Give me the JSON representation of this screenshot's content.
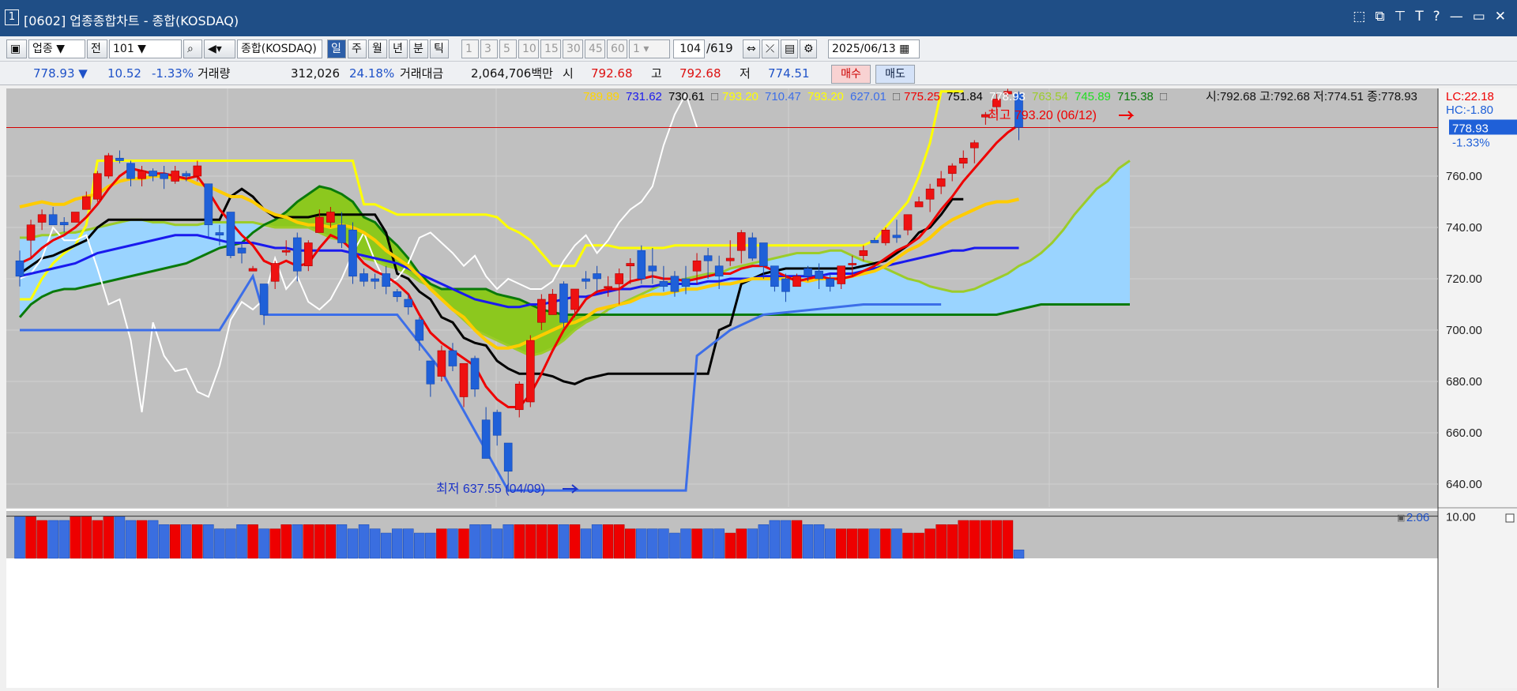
{
  "window": {
    "number": "1",
    "title": "[0602] 업종종합차트 - 종합(KOSDAQ)",
    "controls": [
      "⬚",
      "⧉",
      "⊤",
      "T",
      "?",
      "—",
      "▭",
      "✕"
    ]
  },
  "toolbar": {
    "type_select": "업종",
    "prev_btn": "전",
    "code": "101",
    "market_name": "종합(KOSDAQ)",
    "periods": [
      "일",
      "주",
      "월",
      "년",
      "분",
      "틱"
    ],
    "selected_period": "일",
    "intervals": [
      "1",
      "3",
      "5",
      "10",
      "15",
      "30",
      "45",
      "60"
    ],
    "interval_value": "1",
    "count_current": "104",
    "count_total": "/619",
    "date": "2025/06/13"
  },
  "quote": {
    "price": "778.93 ▼",
    "change": "10.52",
    "change_pct": "-1.33%",
    "volume_label": "거래량",
    "volume": "312,026",
    "volume_pct": "24.18%",
    "amount_label": "거래대금",
    "amount": "2,064,706백만",
    "open_label": "시",
    "open": "792.68",
    "high_label": "고",
    "high": "792.68",
    "low_label": "저",
    "low": "774.51",
    "buy_label": "매수",
    "sell_label": "매도"
  },
  "legend": {
    "items": [
      {
        "text": "789.89",
        "color": "#ffd400"
      },
      {
        "text": "731.62",
        "color": "#1a1aee"
      },
      {
        "text": "730.61",
        "color": "#000000"
      },
      {
        "text": "□",
        "color": "#555555"
      },
      {
        "text": "793.20",
        "color": "#ffff00"
      },
      {
        "text": "710.47",
        "color": "#3c6ee8"
      },
      {
        "text": "793.20",
        "color": "#ffff00"
      },
      {
        "text": "627.01",
        "color": "#3c6ee8"
      },
      {
        "text": "□",
        "color": "#555555"
      },
      {
        "text": "775.25",
        "color": "#ee0000"
      },
      {
        "text": "751.84",
        "color": "#000000"
      },
      {
        "text": "778.93",
        "color": "#ffffff"
      },
      {
        "text": "763.54",
        "color": "#9ccc2a"
      },
      {
        "text": "745.89",
        "color": "#22dd22"
      },
      {
        "text": "715.38",
        "color": "#0a7a0a"
      },
      {
        "text": "□",
        "color": "#555555"
      }
    ],
    "ohlc": "시:792.68 고:792.68 저:774.51 종:778.93",
    "lc": "LC:22.18",
    "hc": "HC:-1.80"
  },
  "annotations": {
    "high": "최고 793.20 (06/12)",
    "low": "최저 637.55 (04/09)"
  },
  "price_axis": {
    "ticks": [
      "760.00",
      "740.00",
      "720.00",
      "700.00",
      "680.00",
      "660.00",
      "640.00"
    ],
    "current": "778.93",
    "current_pct": "-1.33%"
  },
  "volume_axis": {
    "ticks": [
      "10.00"
    ],
    "badge": "2.06",
    "badge_icon": "▣"
  },
  "colors": {
    "up": "#ee1111",
    "down": "#1f60d8",
    "background": "#c0c0c0",
    "cloud_bull": "#9ad4ff",
    "cloud_bear": "#8cc81e"
  },
  "chart_data": {
    "type": "candlestick",
    "ohlc": [
      [
        727,
        731,
        717,
        721
      ],
      [
        735,
        743,
        728,
        741
      ],
      [
        742,
        747,
        739,
        745
      ],
      [
        745,
        748,
        741,
        741
      ],
      [
        742,
        744,
        738,
        741
      ],
      [
        742,
        746,
        742,
        746
      ],
      [
        747,
        754,
        747,
        752
      ],
      [
        751,
        762,
        750,
        761
      ],
      [
        760,
        769,
        759,
        768
      ],
      [
        767,
        770,
        765,
        766
      ],
      [
        765,
        766,
        756,
        759
      ],
      [
        759,
        764,
        756,
        762
      ],
      [
        762,
        763,
        758,
        760
      ],
      [
        761,
        764,
        755,
        759
      ],
      [
        758,
        764,
        757,
        762
      ],
      [
        761,
        762,
        758,
        760
      ],
      [
        760,
        766,
        758,
        764
      ],
      [
        757,
        756,
        736,
        741
      ],
      [
        738,
        741,
        733,
        737
      ],
      [
        746,
        746,
        728,
        729
      ],
      [
        732,
        734,
        726,
        730
      ],
      [
        723,
        725,
        723,
        724
      ],
      [
        718,
        718,
        702,
        706
      ],
      [
        719,
        727,
        716,
        726
      ],
      [
        731,
        735,
        729,
        731
      ],
      [
        736,
        738,
        719,
        723
      ],
      [
        725,
        735,
        723,
        734
      ],
      [
        738,
        747,
        738,
        744
      ],
      [
        742,
        748,
        740,
        746
      ],
      [
        741,
        746,
        732,
        734
      ],
      [
        739,
        742,
        718,
        721
      ],
      [
        722,
        724,
        717,
        719
      ],
      [
        720,
        722,
        716,
        719
      ],
      [
        722,
        725,
        714,
        717
      ],
      [
        715,
        716,
        711,
        713
      ],
      [
        712,
        714,
        706,
        709
      ],
      [
        704,
        705,
        692,
        696
      ],
      [
        688,
        688,
        674,
        679
      ],
      [
        682,
        694,
        680,
        692
      ],
      [
        692,
        695,
        684,
        686
      ],
      [
        674,
        683,
        670,
        687
      ],
      [
        689,
        690,
        674,
        677
      ],
      [
        665,
        670,
        650,
        650
      ],
      [
        668,
        669,
        655,
        659
      ],
      [
        656,
        656,
        637,
        645
      ],
      [
        669,
        680,
        666,
        679
      ],
      [
        672,
        698,
        670,
        696
      ],
      [
        703,
        714,
        700,
        712
      ],
      [
        706,
        716,
        706,
        714
      ],
      [
        718,
        719,
        701,
        703
      ],
      [
        708,
        716,
        705,
        716
      ],
      [
        720,
        723,
        716,
        719
      ],
      [
        722,
        725,
        715,
        720
      ],
      [
        717,
        721,
        713,
        717
      ],
      [
        718,
        724,
        710,
        722
      ],
      [
        725,
        728,
        718,
        726
      ],
      [
        731,
        733,
        718,
        720
      ],
      [
        725,
        732,
        718,
        723
      ],
      [
        719,
        725,
        715,
        717
      ],
      [
        721,
        723,
        713,
        715
      ],
      [
        720,
        725,
        714,
        717
      ],
      [
        723,
        730,
        718,
        727
      ],
      [
        729,
        732,
        720,
        727
      ],
      [
        725,
        729,
        716,
        721
      ],
      [
        727,
        735,
        725,
        728
      ],
      [
        731,
        739,
        726,
        738
      ],
      [
        736,
        738,
        727,
        728
      ],
      [
        734,
        734,
        720,
        725
      ],
      [
        725,
        725,
        715,
        717
      ],
      [
        720,
        722,
        711,
        715
      ],
      [
        717,
        722,
        717,
        721
      ],
      [
        724,
        725,
        719,
        721
      ],
      [
        723,
        726,
        716,
        720
      ],
      [
        720,
        722,
        715,
        717
      ],
      [
        718,
        725,
        716,
        725
      ],
      [
        726,
        729,
        721,
        726
      ],
      [
        729,
        733,
        727,
        731
      ],
      [
        735,
        736,
        734,
        734
      ],
      [
        734,
        740,
        733,
        739
      ],
      [
        737,
        743,
        734,
        736
      ],
      [
        739,
        745,
        737,
        745
      ],
      [
        748,
        752,
        748,
        750
      ],
      [
        751,
        757,
        746,
        755
      ],
      [
        756,
        762,
        753,
        759
      ],
      [
        761,
        765,
        758,
        764
      ],
      [
        765,
        770,
        763,
        767
      ],
      [
        771,
        774,
        765,
        773
      ],
      [
        783,
        785,
        780,
        784
      ],
      [
        787,
        792,
        784,
        790
      ],
      [
        792,
        794,
        791,
        793
      ],
      [
        792,
        793,
        774,
        779
      ]
    ],
    "ma_red": [
      726,
      728,
      732,
      735,
      737,
      740,
      744,
      749,
      755,
      760,
      763,
      762,
      761,
      761,
      760,
      759,
      760,
      754,
      747,
      742,
      737,
      733,
      727,
      725,
      727,
      725,
      726,
      732,
      737,
      735,
      731,
      726,
      723,
      721,
      718,
      714,
      706,
      699,
      695,
      692,
      689,
      686,
      678,
      673,
      670,
      670,
      675,
      683,
      692,
      700,
      706,
      712,
      715,
      716,
      716,
      719,
      720,
      721,
      720,
      720,
      719,
      720,
      721,
      722,
      722,
      724,
      725,
      725,
      723,
      721,
      719,
      720,
      721,
      720,
      720,
      721,
      723,
      725,
      728,
      731,
      733,
      736,
      741,
      747,
      752,
      758,
      763,
      768,
      773,
      777,
      780
    ],
    "ma_yellow": [
      748,
      749,
      750,
      749,
      749,
      751,
      752,
      753,
      756,
      758,
      759,
      759,
      760,
      760,
      759,
      759,
      757,
      756,
      754,
      752,
      752,
      750,
      747,
      745,
      744,
      742,
      741,
      741,
      740,
      741,
      740,
      738,
      735,
      731,
      728,
      725,
      721,
      716,
      712,
      708,
      705,
      700,
      696,
      693,
      693,
      694,
      696,
      698,
      700,
      702,
      703,
      705,
      708,
      709,
      710,
      711,
      713,
      714,
      714,
      715,
      716,
      716,
      717,
      718,
      718,
      719,
      720,
      720,
      720,
      720,
      720,
      719,
      720,
      720,
      720,
      721,
      722,
      723,
      725,
      728,
      731,
      733,
      736,
      740,
      743,
      745,
      747,
      749,
      750,
      750,
      751
    ],
    "ma_blue": [
      721,
      722,
      723,
      724,
      725,
      726,
      728,
      730,
      731,
      732,
      733,
      734,
      735,
      736,
      737,
      737,
      737,
      736,
      735,
      734,
      734,
      734,
      733,
      732,
      732,
      731,
      731,
      731,
      731,
      731,
      730,
      729,
      728,
      727,
      726,
      724,
      722,
      720,
      718,
      716,
      714,
      712,
      711,
      710,
      709,
      709,
      710,
      710,
      711,
      712,
      713,
      713,
      714,
      715,
      716,
      716,
      717,
      717,
      718,
      718,
      718,
      718,
      719,
      719,
      720,
      720,
      720,
      721,
      721,
      721,
      721,
      721,
      721,
      722,
      722,
      722,
      723,
      724,
      725,
      726,
      727,
      728,
      729,
      730,
      731,
      731,
      732,
      732,
      732,
      732,
      732
    ],
    "tenkan": [
      722,
      725,
      728,
      729,
      731,
      733,
      735,
      740,
      743,
      743,
      743,
      743,
      743,
      743,
      743,
      743,
      743,
      743,
      743,
      752,
      755,
      752,
      747,
      744,
      744,
      744,
      744,
      745,
      745,
      745,
      745,
      745,
      745,
      738,
      722,
      720,
      715,
      712,
      705,
      703,
      697,
      695,
      694,
      688,
      685,
      683,
      683,
      683,
      682,
      680,
      679,
      681,
      682,
      683,
      683,
      683,
      683,
      683,
      683,
      683,
      683,
      683,
      683,
      700,
      702,
      718,
      720,
      722,
      723,
      724,
      724,
      724,
      724,
      724,
      724,
      724,
      725,
      726,
      727,
      730,
      733,
      738,
      740,
      745,
      751,
      751
    ],
    "kijun": [
      712,
      712,
      720,
      726,
      730,
      733,
      741,
      766,
      766,
      766,
      766,
      766,
      766,
      766,
      766,
      766,
      766,
      766,
      766,
      766,
      766,
      766,
      766,
      766,
      766,
      766,
      766,
      766,
      766,
      766,
      766,
      749,
      749,
      747,
      745,
      745,
      745,
      745,
      745,
      745,
      745,
      745,
      745,
      744,
      740,
      738,
      735,
      730,
      725,
      725,
      725,
      733,
      733,
      733,
      732,
      732,
      732,
      732,
      732,
      733,
      733,
      733,
      733,
      733,
      733,
      733,
      733,
      733,
      733,
      733,
      733,
      733,
      733,
      733,
      733,
      733,
      733,
      735,
      740,
      745,
      750,
      760,
      773,
      793,
      793,
      793
    ],
    "chikou": [
      720,
      722,
      728,
      740,
      735,
      735,
      737,
      724,
      710,
      712,
      696,
      668,
      703,
      690,
      684,
      685,
      676,
      674,
      686,
      704,
      711,
      708,
      712,
      728,
      716,
      721,
      711,
      708,
      712,
      720,
      730,
      738,
      727,
      718,
      720,
      726,
      736,
      738,
      734,
      730,
      725,
      729,
      721,
      716,
      720,
      718,
      716,
      716,
      719,
      727,
      733,
      737,
      730,
      735,
      742,
      747,
      750,
      756,
      772,
      784,
      792,
      779
    ],
    "span_a": [
      736,
      736,
      737,
      737,
      738,
      738,
      739,
      740,
      741,
      742,
      743,
      743,
      742,
      742,
      741,
      741,
      741,
      742,
      742,
      742,
      742,
      742,
      741,
      740,
      740,
      740,
      740,
      738,
      736,
      735,
      733,
      728,
      727,
      725,
      724,
      722,
      719,
      717,
      712,
      708,
      704,
      700,
      698,
      696,
      694,
      692,
      690,
      691,
      693,
      696,
      700,
      703,
      705,
      708,
      710,
      712,
      714,
      716,
      718,
      719,
      720,
      721,
      722,
      722,
      724,
      725,
      726,
      727,
      728,
      729,
      730,
      730,
      730,
      731,
      731,
      729,
      727,
      726,
      724,
      722,
      720,
      719,
      717,
      716,
      715,
      715,
      716,
      718,
      720,
      722,
      725,
      727,
      730,
      734,
      739,
      745,
      750,
      755,
      758,
      763,
      766
    ],
    "span_b": [
      705,
      710,
      713,
      715,
      716,
      716,
      717,
      718,
      719,
      720,
      721,
      722,
      723,
      724,
      725,
      726,
      728,
      730,
      732,
      733,
      734,
      738,
      741,
      743,
      746,
      750,
      753,
      756,
      755,
      753,
      750,
      744,
      742,
      737,
      733,
      728,
      722,
      718,
      716,
      716,
      716,
      716,
      716,
      714,
      713,
      712,
      710,
      708,
      707,
      706,
      706,
      706,
      706,
      706,
      706,
      706,
      706,
      706,
      706,
      706,
      706,
      706,
      706,
      706,
      706,
      706,
      706,
      706,
      706,
      706,
      706,
      706,
      706,
      706,
      706,
      706,
      706,
      706,
      706,
      706,
      706,
      706,
      706,
      706,
      706,
      706,
      706,
      706,
      706,
      707,
      708,
      709,
      710,
      710,
      710,
      710,
      710,
      710,
      710,
      710,
      710
    ],
    "volume": [
      10,
      10,
      9,
      9,
      9,
      10,
      10,
      9,
      10,
      10,
      9,
      9,
      9,
      8,
      8,
      8,
      8,
      8,
      7,
      7,
      8,
      8,
      7,
      7,
      8,
      8,
      8,
      8,
      8,
      8,
      7,
      8,
      7,
      6,
      7,
      7,
      6,
      6,
      7,
      7,
      7,
      8,
      8,
      7,
      8,
      8,
      8,
      8,
      8,
      8,
      8,
      7,
      8,
      8,
      8,
      7,
      7,
      7,
      7,
      6,
      7,
      7,
      7,
      7,
      6,
      7,
      7,
      8,
      9,
      9,
      9,
      8,
      8,
      7,
      7,
      7,
      7,
      7,
      7,
      7,
      6,
      6,
      7,
      8,
      8,
      9,
      9,
      9,
      9,
      9,
      2
    ]
  }
}
